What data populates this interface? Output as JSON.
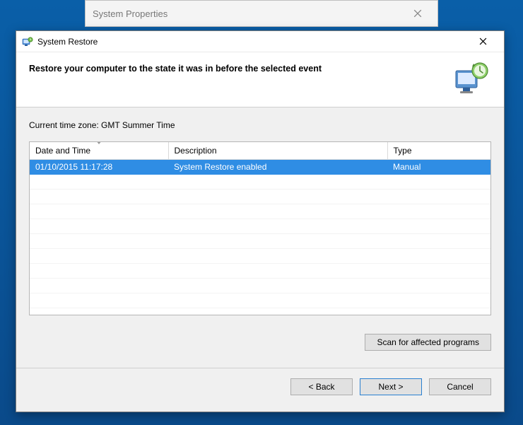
{
  "back_window": {
    "title": "System Properties"
  },
  "front_window": {
    "title": "System Restore",
    "header": "Restore your computer to the state it was in before the selected event"
  },
  "timezone_line": "Current time zone: GMT Summer Time",
  "table": {
    "columns": {
      "date": "Date and Time",
      "description": "Description",
      "type": "Type"
    },
    "rows": [
      {
        "date": "01/10/2015 11:17:28",
        "description": "System Restore enabled",
        "type": "Manual"
      }
    ]
  },
  "buttons": {
    "scan": "Scan for affected programs",
    "back": "< Back",
    "next": "Next >",
    "cancel": "Cancel"
  }
}
